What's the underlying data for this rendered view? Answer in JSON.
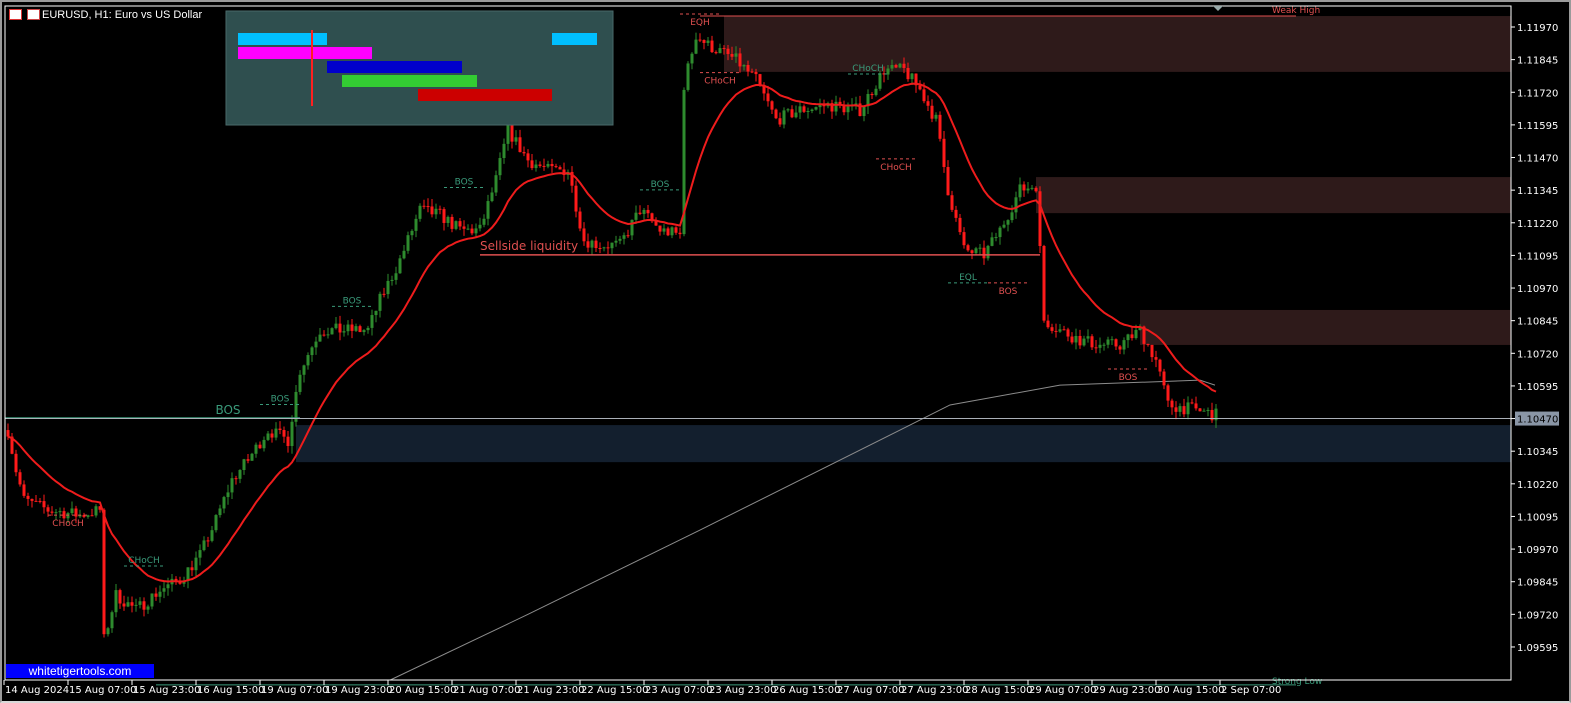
{
  "window": {
    "title": "EURUSD, H1:  Euro vs US Dollar",
    "watermark": "whitetigertools.com"
  },
  "current_price": "1.10470",
  "colors": {
    "bull": "#2e8b2e",
    "bear": "#ff1a1a",
    "ema": "#ee1c1c",
    "slow_ma": "#8c8c8c",
    "supply_zone": "#2e1a1a",
    "demand_zone": "#131f2e",
    "bull_label": "#3a9a7a",
    "bear_label": "#e05050",
    "panel": "#2f4f4f"
  },
  "chart_data": {
    "type": "candlestick",
    "symbol": "EURUSD",
    "timeframe": "H1",
    "ylim": [
      1.0948,
      1.1205
    ],
    "y_ticks": [
      "1.11970",
      "1.11845",
      "1.11720",
      "1.11595",
      "1.11470",
      "1.11345",
      "1.11220",
      "1.11095",
      "1.10970",
      "1.10845",
      "1.10720",
      "1.10595",
      "1.10470",
      "1.10345",
      "1.10220",
      "1.10095",
      "1.09970",
      "1.09845",
      "1.09720",
      "1.09595"
    ],
    "x_ticks": [
      "14 Aug 2024",
      "15 Aug 07:00",
      "15 Aug 23:00",
      "16 Aug 15:00",
      "19 Aug 07:00",
      "19 Aug 23:00",
      "20 Aug 15:00",
      "21 Aug 07:00",
      "21 Aug 23:00",
      "22 Aug 15:00",
      "23 Aug 07:00",
      "23 Aug 23:00",
      "26 Aug 15:00",
      "27 Aug 07:00",
      "27 Aug 23:00",
      "28 Aug 15:00",
      "29 Aug 07:00",
      "29 Aug 23:00",
      "30 Aug 15:00",
      "2 Sep 07:00"
    ],
    "bars_between_ticks": 16,
    "close_path": [
      [
        0,
        1.10426
      ],
      [
        2,
        1.10273
      ],
      [
        4,
        1.10158
      ],
      [
        10,
        1.1012
      ],
      [
        18,
        1.101
      ],
      [
        23,
        1.1012
      ],
      [
        24,
        1.09622
      ],
      [
        27,
        1.09794
      ],
      [
        32,
        1.09737
      ],
      [
        38,
        1.09813
      ],
      [
        43,
        1.09851
      ],
      [
        48,
        1.09947
      ],
      [
        52,
        1.10081
      ],
      [
        56,
        1.10235
      ],
      [
        60,
        1.10311
      ],
      [
        65,
        1.10426
      ],
      [
        70,
        1.10388
      ],
      [
        73,
        1.10656
      ],
      [
        78,
        1.10809
      ],
      [
        86,
        1.10809
      ],
      [
        90,
        1.10809
      ],
      [
        93,
        1.10924
      ],
      [
        98,
        1.11077
      ],
      [
        103,
        1.11269
      ],
      [
        108,
        1.1125
      ],
      [
        113,
        1.11192
      ],
      [
        118,
        1.11192
      ],
      [
        122,
        1.11384
      ],
      [
        125,
        1.11575
      ],
      [
        130,
        1.1146
      ],
      [
        135,
        1.11422
      ],
      [
        140,
        1.11422
      ],
      [
        144,
        1.11154
      ],
      [
        148,
        1.11135
      ],
      [
        153,
        1.11135
      ],
      [
        158,
        1.11269
      ],
      [
        163,
        1.11192
      ],
      [
        168,
        1.11173
      ],
      [
        169,
        1.11748
      ],
      [
        172,
        1.11939
      ],
      [
        175,
        1.11901
      ],
      [
        182,
        1.11844
      ],
      [
        187,
        1.11767
      ],
      [
        192,
        1.11614
      ],
      [
        198,
        1.11652
      ],
      [
        205,
        1.11671
      ],
      [
        213,
        1.11652
      ],
      [
        219,
        1.11805
      ],
      [
        224,
        1.11805
      ],
      [
        228,
        1.11729
      ],
      [
        232,
        1.11614
      ],
      [
        235,
        1.11346
      ],
      [
        239,
        1.11116
      ],
      [
        244,
        1.11097
      ],
      [
        248,
        1.11192
      ],
      [
        253,
        1.11346
      ],
      [
        257,
        1.11365
      ],
      [
        258,
        1.11116
      ],
      [
        259,
        1.10848
      ],
      [
        263,
        1.10809
      ],
      [
        268,
        1.10771
      ],
      [
        273,
        1.10752
      ],
      [
        278,
        1.10752
      ],
      [
        283,
        1.10809
      ],
      [
        287,
        1.10694
      ],
      [
        290,
        1.10522
      ],
      [
        297,
        1.10503
      ],
      [
        302,
        1.10484
      ]
    ],
    "ema_period": 20,
    "slow_ma_path": [
      [
        95.5,
        1.09468
      ],
      [
        130,
        1.0972
      ],
      [
        173,
        1.10043
      ],
      [
        223,
        1.10426
      ],
      [
        235.5,
        1.10522
      ],
      [
        263,
        1.10598
      ],
      [
        298,
        1.10617
      ],
      [
        301.75,
        1.10598
      ]
    ],
    "zones": [
      {
        "type": "supply",
        "from_bar": 179,
        "price_top": 1.12012,
        "price_bottom": 1.11798
      },
      {
        "type": "supply",
        "from_bar": 257,
        "price_top": 1.11395,
        "price_bottom": 1.11257
      },
      {
        "type": "supply",
        "from_bar": 283,
        "price_top": 1.10886,
        "price_bottom": 1.10752
      },
      {
        "type": "demand",
        "from_bar": 72,
        "price_top": 1.10445,
        "price_bottom": 1.10303
      }
    ],
    "levels": [
      {
        "label": "BOS",
        "price": 1.10472,
        "from_bar": -1,
        "to_bar": 73,
        "kind": "bull",
        "major": true
      },
      {
        "label": "Sellside liquidity",
        "price": 1.11097,
        "from_bar": 118,
        "to_bar": 258,
        "kind": "bear",
        "major": true
      },
      {
        "label": "Weak High",
        "price": 1.12012,
        "from_bar": 173,
        "to_bar": 322,
        "kind": "bear",
        "major": false
      },
      {
        "label": "Strong Low",
        "price": 1.0945,
        "from_bar": 37,
        "to_bar": 322,
        "kind": "bull",
        "major": false
      }
    ],
    "structure_labels": [
      {
        "label": "CHoCH",
        "bar": 15,
        "price": 1.101,
        "kind": "bear"
      },
      {
        "label": "CHoCH",
        "bar": 34,
        "price": 1.09905,
        "kind": "bull"
      },
      {
        "label": "BOS",
        "bar": 68,
        "price": 1.10524,
        "kind": "bull"
      },
      {
        "label": "BOS",
        "bar": 86,
        "price": 1.109,
        "kind": "bull"
      },
      {
        "label": "BOS",
        "bar": 114,
        "price": 1.11355,
        "kind": "bull"
      },
      {
        "label": "BOS",
        "bar": 163,
        "price": 1.11346,
        "kind": "bull"
      },
      {
        "label": "EQH",
        "bar": 173,
        "price": 1.1202,
        "kind": "bear"
      },
      {
        "label": "CHoCH",
        "bar": 178,
        "price": 1.11795,
        "kind": "bear"
      },
      {
        "label": "CHoCH",
        "bar": 215,
        "price": 1.1179,
        "kind": "bull"
      },
      {
        "label": "CHoCH",
        "bar": 222,
        "price": 1.11465,
        "kind": "bear"
      },
      {
        "label": "EQL",
        "bar": 240,
        "price": 1.1099,
        "kind": "bull"
      },
      {
        "label": "BOS",
        "bar": 250,
        "price": 1.1099,
        "kind": "bear"
      },
      {
        "label": "BOS",
        "bar": 280,
        "price": 1.1066,
        "kind": "bear"
      }
    ]
  }
}
